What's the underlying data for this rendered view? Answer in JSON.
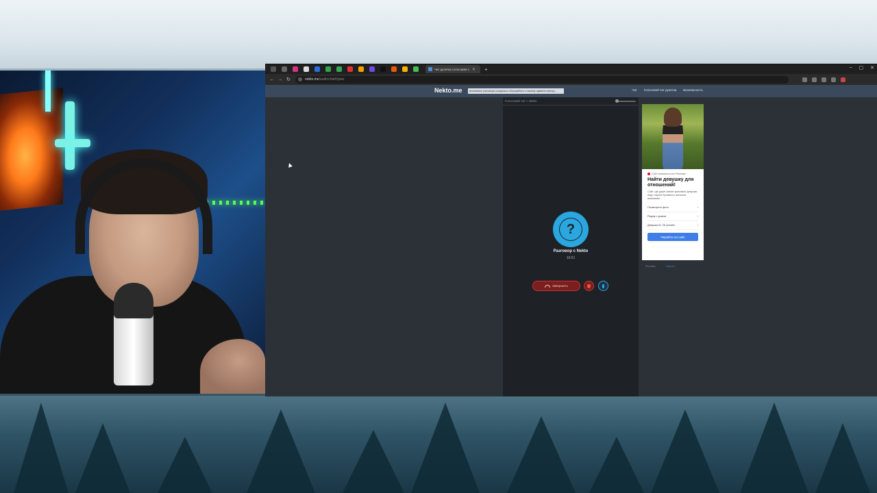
{
  "browser": {
    "active_tab_title": "Чат рулетка голосовая с",
    "url_domain": "nekto.me",
    "url_path": "/audiochat#/peer"
  },
  "site": {
    "logo": "Nekto.me",
    "notice": "анонимные разговоры учащались обращайтесь к нашему администратору ...",
    "nav": [
      "Чат",
      "Голосовой чат рулетка",
      "Безопасность"
    ]
  },
  "chat": {
    "header_label": "Голосовой чат с Nekto",
    "avatar_symbol": "?",
    "conversation_title": "Разговор с Nekto",
    "timer": "16:51",
    "end_button_label": "Завершить"
  },
  "ad": {
    "source": "Сайт знакомств.com Реклама",
    "headline": "Найти девушку для отношений!",
    "body": "Сайт, где даже самые красивые девушки ищут парня! Купайся в женском внимании!",
    "links": [
      "Посмотреть фото",
      "Рядом с домом",
      "Девушки М. 25 онлайн"
    ],
    "cta": "Перейти на сайт",
    "footer_left": "Реклама",
    "footer_right": "Закрыть"
  },
  "colors": {
    "accent": "#2aa7e0",
    "end_call": "#7a1e1e",
    "cta": "#3f7ee8"
  }
}
